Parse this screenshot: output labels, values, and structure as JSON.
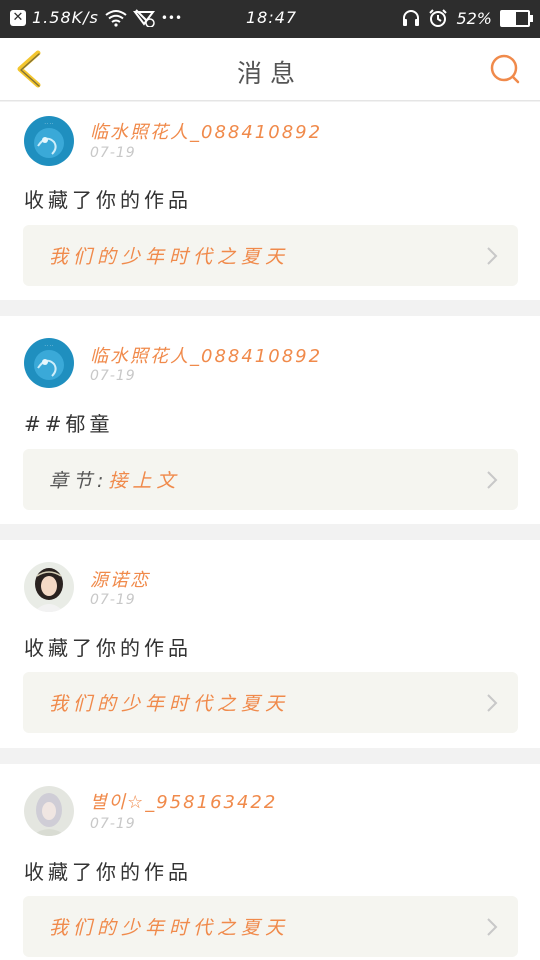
{
  "status_bar": {
    "speed": "1.58K/s",
    "more": "•••",
    "time": "18:47",
    "battery_percent": "52%",
    "battery_level": 0.52
  },
  "header": {
    "title": "消息"
  },
  "colors": {
    "accent": "#f08a4b",
    "link_bg": "#f5f5f0",
    "status_bar_bg": "#2d2d2d",
    "back_arrow": "#f3c62e"
  },
  "messages": [
    {
      "username": "临水照花人_088410892",
      "time": "07-19",
      "text": "收藏了你的作品",
      "link_prefix": "",
      "link_title": "我们的少年时代之夏天",
      "avatar": "blue-avatar"
    },
    {
      "username": "临水照花人_088410892",
      "time": "07-19",
      "text": "##郁童",
      "link_prefix": "章节:",
      "link_title": "接上文",
      "avatar": "blue-avatar"
    },
    {
      "username": "源诺恋",
      "time": "07-19",
      "text": "收藏了你的作品",
      "link_prefix": "",
      "link_title": "我们的少年时代之夏天",
      "avatar": "portrait-avatar"
    },
    {
      "username": "별이☆_958163422",
      "time": "07-19",
      "text": "收藏了你的作品",
      "link_prefix": "",
      "link_title": "我们的少年时代之夏天",
      "avatar": "pale-avatar"
    }
  ]
}
